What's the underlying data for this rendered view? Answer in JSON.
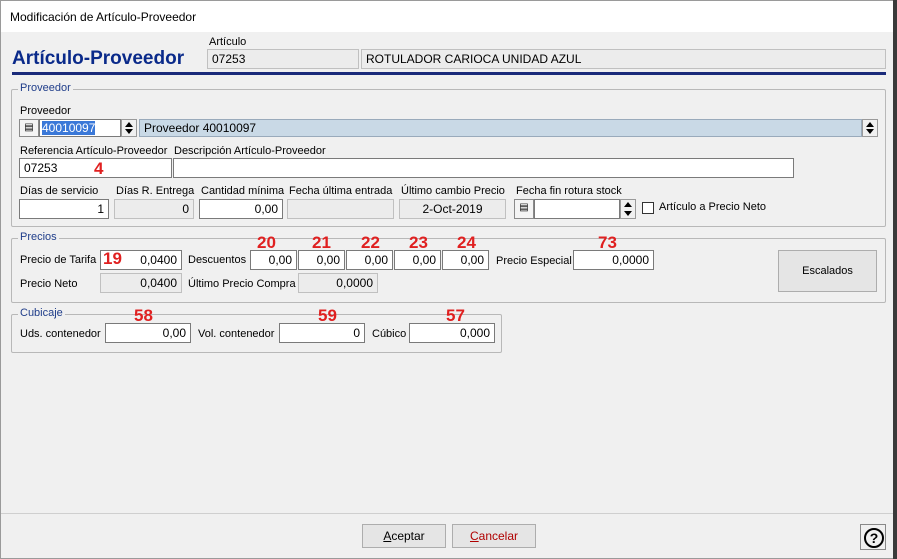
{
  "window": {
    "title": "Modificación de Artículo-Proveedor"
  },
  "header": {
    "title": "Artículo-Proveedor",
    "articulo_label": "Artículo",
    "articulo_code": "07253",
    "articulo_desc": "ROTULADOR CARIOCA UNIDAD AZUL"
  },
  "proveedor_group": {
    "title": "Proveedor",
    "proveedor_label": "Proveedor",
    "proveedor_code": "40010097",
    "proveedor_name": "Proveedor 40010097",
    "ref_label": "Referencia Artículo-Proveedor",
    "ref_value": "07253",
    "desc_label": "Descripción Artículo-Proveedor",
    "desc_value": "",
    "dias_servicio_label": "Días de servicio",
    "dias_servicio_value": "1",
    "dias_entrega_label": "Días R. Entrega",
    "dias_entrega_value": "0",
    "cantidad_minima_label": "Cantidad mínima",
    "cantidad_minima_value": "0,00",
    "fecha_ultima_label": "Fecha última entrada",
    "fecha_ultima_value": "",
    "ultimo_cambio_label": "Último cambio Precio",
    "ultimo_cambio_value": "2-Oct-2019",
    "fecha_fin_label": "Fecha fin rotura stock",
    "fecha_fin_value": "",
    "precio_neto_check_label": "Artículo a Precio Neto"
  },
  "precios_group": {
    "title": "Precios",
    "precio_tarifa_label": "Precio de Tarifa",
    "precio_tarifa_value": "0,0400",
    "descuentos_label": "Descuentos",
    "descuentos": [
      "0,00",
      "0,00",
      "0,00",
      "0,00",
      "0,00"
    ],
    "precio_especial_label": "Precio Especial",
    "precio_especial_value": "0,0000",
    "precio_neto_label": "Precio Neto",
    "precio_neto_value": "0,0400",
    "ultimo_precio_label": "Último Precio Compra",
    "ultimo_precio_value": "0,0000",
    "escalados_label": "Escalados"
  },
  "cubicaje_group": {
    "title": "Cubicaje",
    "uds_label": "Uds. contenedor",
    "uds_value": "0,00",
    "vol_label": "Vol. contenedor",
    "vol_value": "0",
    "cubico_label": "Cúbico",
    "cubico_value": "0,000"
  },
  "annotations": {
    "a4": "4",
    "a19": "19",
    "a20": "20",
    "a21": "21",
    "a22": "22",
    "a23": "23",
    "a24": "24",
    "a73": "73",
    "a58": "58",
    "a59": "59",
    "a57": "57"
  },
  "footer": {
    "aceptar_first": "A",
    "aceptar_rest": "ceptar",
    "cancelar_first": "C",
    "cancelar_rest": "ancelar",
    "help_label": "?"
  },
  "colors": {
    "accent": "#0a2a8a",
    "annotation": "#e02020"
  }
}
